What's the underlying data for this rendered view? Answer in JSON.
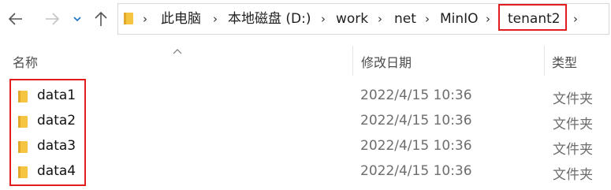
{
  "nav": {
    "back_icon": "back-arrow-icon",
    "forward_icon": "forward-arrow-icon",
    "recent_icon": "chevron-down-icon",
    "up_icon": "up-arrow-icon"
  },
  "breadcrumb": {
    "items": [
      "此电脑",
      "本地磁盘 (D:)",
      "work",
      "net",
      "MinIO",
      "tenant2"
    ],
    "separator": "›",
    "highlight_color": "#e11d1d"
  },
  "columns": {
    "name": "名称",
    "modified": "修改日期",
    "type": "类型",
    "sort_icon": "sort-up-icon"
  },
  "rows": [
    {
      "name": "data1",
      "modified": "2022/4/15 10:36",
      "type": "文件夹"
    },
    {
      "name": "data2",
      "modified": "2022/4/15 10:36",
      "type": "文件夹"
    },
    {
      "name": "data3",
      "modified": "2022/4/15 10:36",
      "type": "文件夹"
    },
    {
      "name": "data4",
      "modified": "2022/4/15 10:36",
      "type": "文件夹"
    }
  ],
  "colors": {
    "folder": "#f5c542",
    "highlight_box": "#e11d1d"
  }
}
